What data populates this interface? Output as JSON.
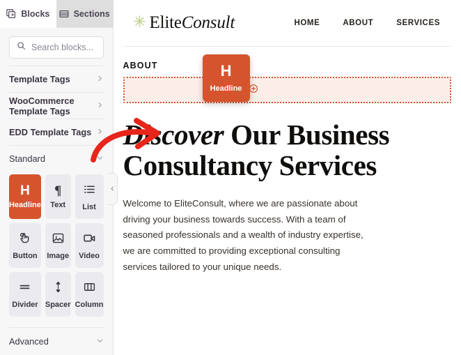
{
  "sidebar": {
    "tabs": [
      {
        "label": "Blocks",
        "icon": "blocks-icon",
        "active": true
      },
      {
        "label": "Sections",
        "icon": "sections-icon",
        "active": false
      }
    ],
    "search": {
      "placeholder": "Search blocks...",
      "value": "",
      "icon": "search-icon"
    },
    "categories": [
      {
        "label": "Template Tags",
        "state": "collapsed",
        "icon": "chevron-right-icon"
      },
      {
        "label": "WooCommerce Template Tags",
        "state": "collapsed",
        "icon": "chevron-right-icon"
      },
      {
        "label": "EDD Template Tags",
        "state": "collapsed",
        "icon": "chevron-right-icon"
      },
      {
        "label": "Standard",
        "state": "expanded",
        "icon": "chevron-down-icon"
      }
    ],
    "blocks": [
      {
        "label": "Headline",
        "icon": "headline-icon",
        "selected": true
      },
      {
        "label": "Text",
        "icon": "paragraph-icon",
        "selected": false
      },
      {
        "label": "List",
        "icon": "list-icon",
        "selected": false
      },
      {
        "label": "Button",
        "icon": "button-click-icon",
        "selected": false
      },
      {
        "label": "Image",
        "icon": "image-icon",
        "selected": false
      },
      {
        "label": "Video",
        "icon": "video-icon",
        "selected": false
      },
      {
        "label": "Divider",
        "icon": "divider-icon",
        "selected": false
      },
      {
        "label": "Spacer",
        "icon": "spacer-icon",
        "selected": false
      },
      {
        "label": "Column",
        "icon": "column-icon",
        "selected": false
      }
    ],
    "advanced": {
      "label": "Advanced",
      "state": "collapsed",
      "icon": "chevron-down-icon"
    },
    "collapse_handle": {
      "icon": "chevron-left-icon"
    }
  },
  "preview": {
    "logo": {
      "icon": "asterisk-star-icon",
      "text_regular": "Elite",
      "text_italic": "Consult"
    },
    "nav": [
      {
        "label": "HOME"
      },
      {
        "label": "ABOUT"
      },
      {
        "label": "SERVICES"
      }
    ],
    "eyebrow": "ABOUT",
    "dropzone": {
      "plus_icon": "plus-circle-icon"
    },
    "drag_ghost": {
      "glyph": "H",
      "label": "Headline"
    },
    "hero": {
      "title_italic": "Discover",
      "title_rest": " Our Business Consultancy Services",
      "paragraph": "Welcome to EliteConsult, where we are passionate about driving your business towards success. With a team of seasoned professionals and a wealth of industry expertise, we are committed to providing exceptional consulting services tailored to your unique needs."
    }
  },
  "annotation": {
    "type": "curved-arrow",
    "color": "#e8251a",
    "points_to": "EDD Template Tags"
  },
  "colors": {
    "accent_orange": "#d5542e",
    "dropzone_fill": "#fbeee9",
    "sidebar_bg": "#f7f7f8",
    "card_bg": "#ebebef",
    "logo_star": "#c8d49a",
    "annotation_red": "#e8251a"
  }
}
